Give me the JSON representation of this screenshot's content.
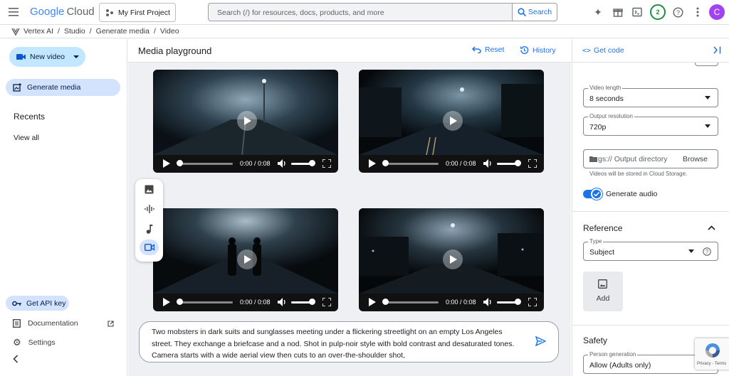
{
  "topbar": {
    "logo_google": "Google",
    "logo_cloud": "Cloud",
    "project": "My First Project",
    "search_placeholder": "Search (/) for resources, docs, products, and more",
    "search_button": "Search",
    "notifications_count": "2",
    "avatar_initial": "C"
  },
  "breadcrumb": {
    "items": [
      "Vertex AI",
      "Studio",
      "Generate media",
      "Video"
    ],
    "separator": "/"
  },
  "sidebar": {
    "new_video": "New video",
    "generate_media": "Generate media",
    "recents": "Recents",
    "view_all": "View all",
    "get_api_key": "Get API key",
    "documentation": "Documentation",
    "settings": "Settings"
  },
  "main": {
    "title": "Media playground",
    "reset": "Reset",
    "history": "History",
    "videos": [
      {
        "time": "0:00 / 0:08"
      },
      {
        "time": "0:00 / 0:08"
      },
      {
        "time": "0:00 / 0:08"
      },
      {
        "time": "0:00 / 0:08"
      }
    ],
    "prompt": "Two mobsters in dark suits and sunglasses meeting under a flickering streetlight on an empty Los Angeles street. They exchange a briefcase and a nod. Shot in pulp-noir style with bold contrast and desaturated tones. Camera starts with a wide aerial view then cuts to an over-the-shoulder shot,"
  },
  "right_panel": {
    "get_code": "Get code",
    "video_length_label": "Video length",
    "video_length": "8 seconds",
    "output_resolution_label": "Output resolution",
    "output_resolution": "720p",
    "output_dir_placeholder": "gs:// Output directory",
    "browse": "Browse",
    "storage_note": "Videos will be stored in Cloud Storage.",
    "generate_audio": "Generate audio",
    "generate_audio_on": true,
    "reference_title": "Reference",
    "type_label": "Type",
    "type_value": "Subject",
    "add": "Add",
    "safety_title": "Safety",
    "person_gen_label": "Person generation",
    "person_gen_value": "Allow (Adults only)",
    "recaptcha": "Privacy - Terms"
  },
  "colors": {
    "accent": "#1a73e8",
    "chip": "#d3e3fd",
    "new_video_chip": "#c2e7ff",
    "canvas": "#eef0f3",
    "avatar": "#a142f4",
    "badge": "#1e8e3e"
  }
}
